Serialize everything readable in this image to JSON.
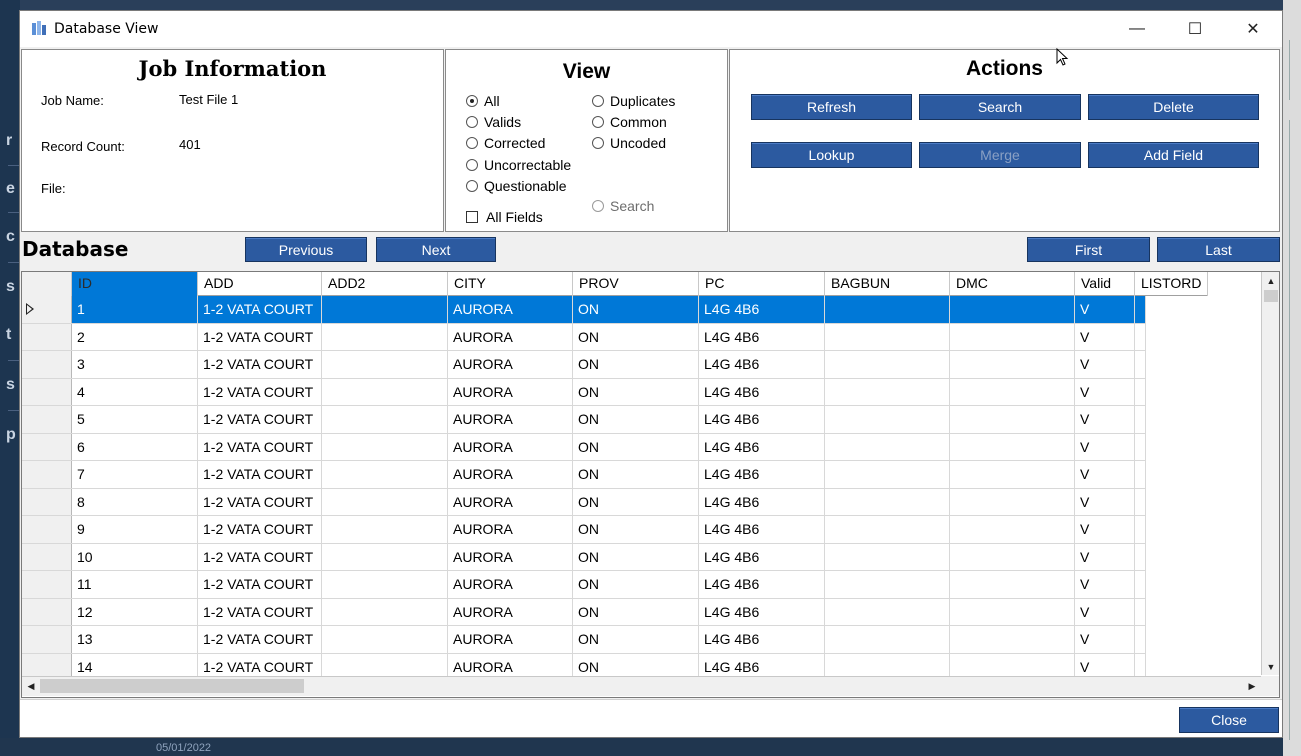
{
  "window": {
    "title": "Database View",
    "minimize_glyph": "—",
    "maximize_glyph": "☐",
    "close_glyph": "✕"
  },
  "job_info": {
    "heading": "Job Information",
    "job_name_label": "Job Name:",
    "job_name_value": "Test File 1",
    "record_count_label": "Record Count:",
    "record_count_value": "401",
    "file_label": "File:",
    "file_value": ""
  },
  "view": {
    "heading": "View",
    "options": [
      {
        "label": "All",
        "selected": true
      },
      {
        "label": "Valids",
        "selected": false
      },
      {
        "label": "Corrected",
        "selected": false
      },
      {
        "label": "Uncorrectable",
        "selected": false
      },
      {
        "label": "Questionable",
        "selected": false
      },
      {
        "label": "Duplicates",
        "selected": false
      },
      {
        "label": "Common",
        "selected": false
      },
      {
        "label": "Uncoded",
        "selected": false
      },
      {
        "label": "Search",
        "selected": false,
        "disabled": true
      }
    ],
    "all_fields_label": "All Fields",
    "all_fields_checked": false
  },
  "actions": {
    "heading": "Actions",
    "refresh": "Refresh",
    "search": "Search",
    "delete": "Delete",
    "lookup": "Lookup",
    "merge": "Merge",
    "add_field": "Add Field"
  },
  "database": {
    "title": "Database",
    "previous": "Previous",
    "next": "Next",
    "first": "First",
    "last": "Last"
  },
  "grid": {
    "columns": [
      "ID",
      "ADD",
      "ADD2",
      "CITY",
      "PROV",
      "PC",
      "BAGBUN",
      "DMC",
      "Valid",
      "LISTORD"
    ],
    "rows": [
      [
        "1",
        "1-2 VATA COURT",
        "",
        "AURORA",
        "ON",
        "L4G 4B6",
        "",
        "",
        "V",
        ""
      ],
      [
        "2",
        "1-2 VATA COURT",
        "",
        "AURORA",
        "ON",
        "L4G 4B6",
        "",
        "",
        "V",
        ""
      ],
      [
        "3",
        "1-2 VATA COURT",
        "",
        "AURORA",
        "ON",
        "L4G 4B6",
        "",
        "",
        "V",
        ""
      ],
      [
        "4",
        "1-2 VATA COURT",
        "",
        "AURORA",
        "ON",
        "L4G 4B6",
        "",
        "",
        "V",
        ""
      ],
      [
        "5",
        "1-2 VATA COURT",
        "",
        "AURORA",
        "ON",
        "L4G 4B6",
        "",
        "",
        "V",
        ""
      ],
      [
        "6",
        "1-2 VATA COURT",
        "",
        "AURORA",
        "ON",
        "L4G 4B6",
        "",
        "",
        "V",
        ""
      ],
      [
        "7",
        "1-2 VATA COURT",
        "",
        "AURORA",
        "ON",
        "L4G 4B6",
        "",
        "",
        "V",
        ""
      ],
      [
        "8",
        "1-2 VATA COURT",
        "",
        "AURORA",
        "ON",
        "L4G 4B6",
        "",
        "",
        "V",
        ""
      ],
      [
        "9",
        "1-2 VATA COURT",
        "",
        "AURORA",
        "ON",
        "L4G 4B6",
        "",
        "",
        "V",
        ""
      ],
      [
        "10",
        "1-2 VATA COURT",
        "",
        "AURORA",
        "ON",
        "L4G 4B6",
        "",
        "",
        "V",
        ""
      ],
      [
        "11",
        "1-2 VATA COURT",
        "",
        "AURORA",
        "ON",
        "L4G 4B6",
        "",
        "",
        "V",
        ""
      ],
      [
        "12",
        "1-2 VATA COURT",
        "",
        "AURORA",
        "ON",
        "L4G 4B6",
        "",
        "",
        "V",
        ""
      ],
      [
        "13",
        "1-2 VATA COURT",
        "",
        "AURORA",
        "ON",
        "L4G 4B6",
        "",
        "",
        "V",
        ""
      ],
      [
        "14",
        "1-2 VATA COURT",
        "",
        "AURORA",
        "ON",
        "L4G 4B6",
        "",
        "",
        "V",
        ""
      ]
    ],
    "selected_row": 0,
    "scroll_up_glyph": "▲",
    "scroll_down_glyph": "▼",
    "scroll_left_glyph": "◀",
    "scroll_right_glyph": "▶"
  },
  "footer": {
    "close": "Close"
  },
  "background": {
    "left_fragments": [
      "r",
      "e",
      "c",
      "s",
      "t",
      "s",
      "p"
    ],
    "date": "05/01/2022"
  },
  "colors": {
    "button_blue": "#2c5aa0",
    "selection_blue": "#0078d7"
  }
}
